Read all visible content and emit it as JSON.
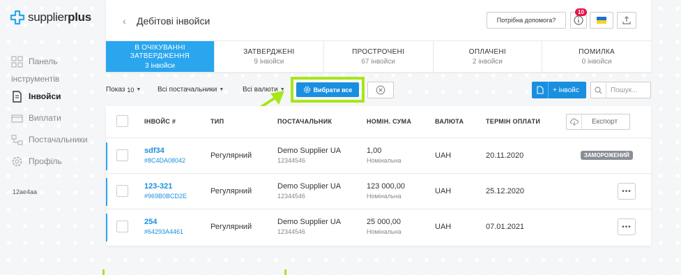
{
  "brand": {
    "name_light": "supplier",
    "name_bold": "plus",
    "accent": "#29a6ee",
    "highlight": "#a8e619"
  },
  "sidebar": {
    "items": [
      {
        "label": "Панель",
        "label2": "інструментів",
        "icon": "dashboard-icon",
        "active": false
      },
      {
        "label": "Інвойси",
        "icon": "invoice-icon",
        "active": true
      },
      {
        "label": "Виплати",
        "icon": "payments-icon",
        "active": false
      },
      {
        "label": "Постачальники",
        "icon": "suppliers-icon",
        "active": false
      },
      {
        "label": "Профіль",
        "icon": "gear-icon",
        "active": false
      }
    ],
    "user_id": "12ae4aa"
  },
  "header": {
    "back_glyph": "‹",
    "title": "Дебітові інвойси",
    "help_label": "Потрібна допомога?",
    "notifications_count": "10"
  },
  "tabs": [
    {
      "name": "В очікуванні затвердження",
      "count": "3 інвойси",
      "active": true
    },
    {
      "name": "Затверджені",
      "count": "9 інвойси",
      "active": false
    },
    {
      "name": "Прострочені",
      "count": "67 інвойси",
      "active": false
    },
    {
      "name": "Оплачені",
      "count": "2 інвойси",
      "active": false
    },
    {
      "name": "Помилка",
      "count": "0 інвойси",
      "active": false
    }
  ],
  "filters": {
    "show_label": "Показ",
    "show_value": "10",
    "suppliers": "Всі постачальники",
    "currencies": "Всі валюти",
    "select_all": "Вибрати все",
    "new_invoice": "+ інвойс",
    "search_placeholder": "Пошук..."
  },
  "table": {
    "headers": {
      "invoice": "Інвойс #",
      "type": "Тип",
      "supplier": "Постачальник",
      "amount": "Номін. сума",
      "currency": "Валюта",
      "due": "Термін оплати"
    },
    "export_label": "Експорт",
    "rows": [
      {
        "no": "sdf34",
        "hash": "#8C4DA08042",
        "type": "Регулярний",
        "supplier": "Demo Supplier UA",
        "supplier_code": "12344546",
        "amount": "1,00",
        "amount_sub": "Номінальна",
        "currency": "UAH",
        "due": "20.11.2020",
        "status": "ЗАМОРОЖЕНИЙ"
      },
      {
        "no": "123-321",
        "hash": "#969B0BCD2E",
        "type": "Регулярний",
        "supplier": "Demo Supplier UA",
        "supplier_code": "12344546",
        "amount": "123 000,00",
        "amount_sub": "Номінальна",
        "currency": "UAH",
        "due": "25.12.2020",
        "actions": "•••"
      },
      {
        "no": "254",
        "hash": "#64293A4461",
        "type": "Регулярний",
        "supplier": "Demo Supplier UA",
        "supplier_code": "12344546",
        "amount": "25 000,00",
        "amount_sub": "Номінальна",
        "currency": "UAH",
        "due": "07.01.2021",
        "actions": "•••"
      }
    ]
  }
}
